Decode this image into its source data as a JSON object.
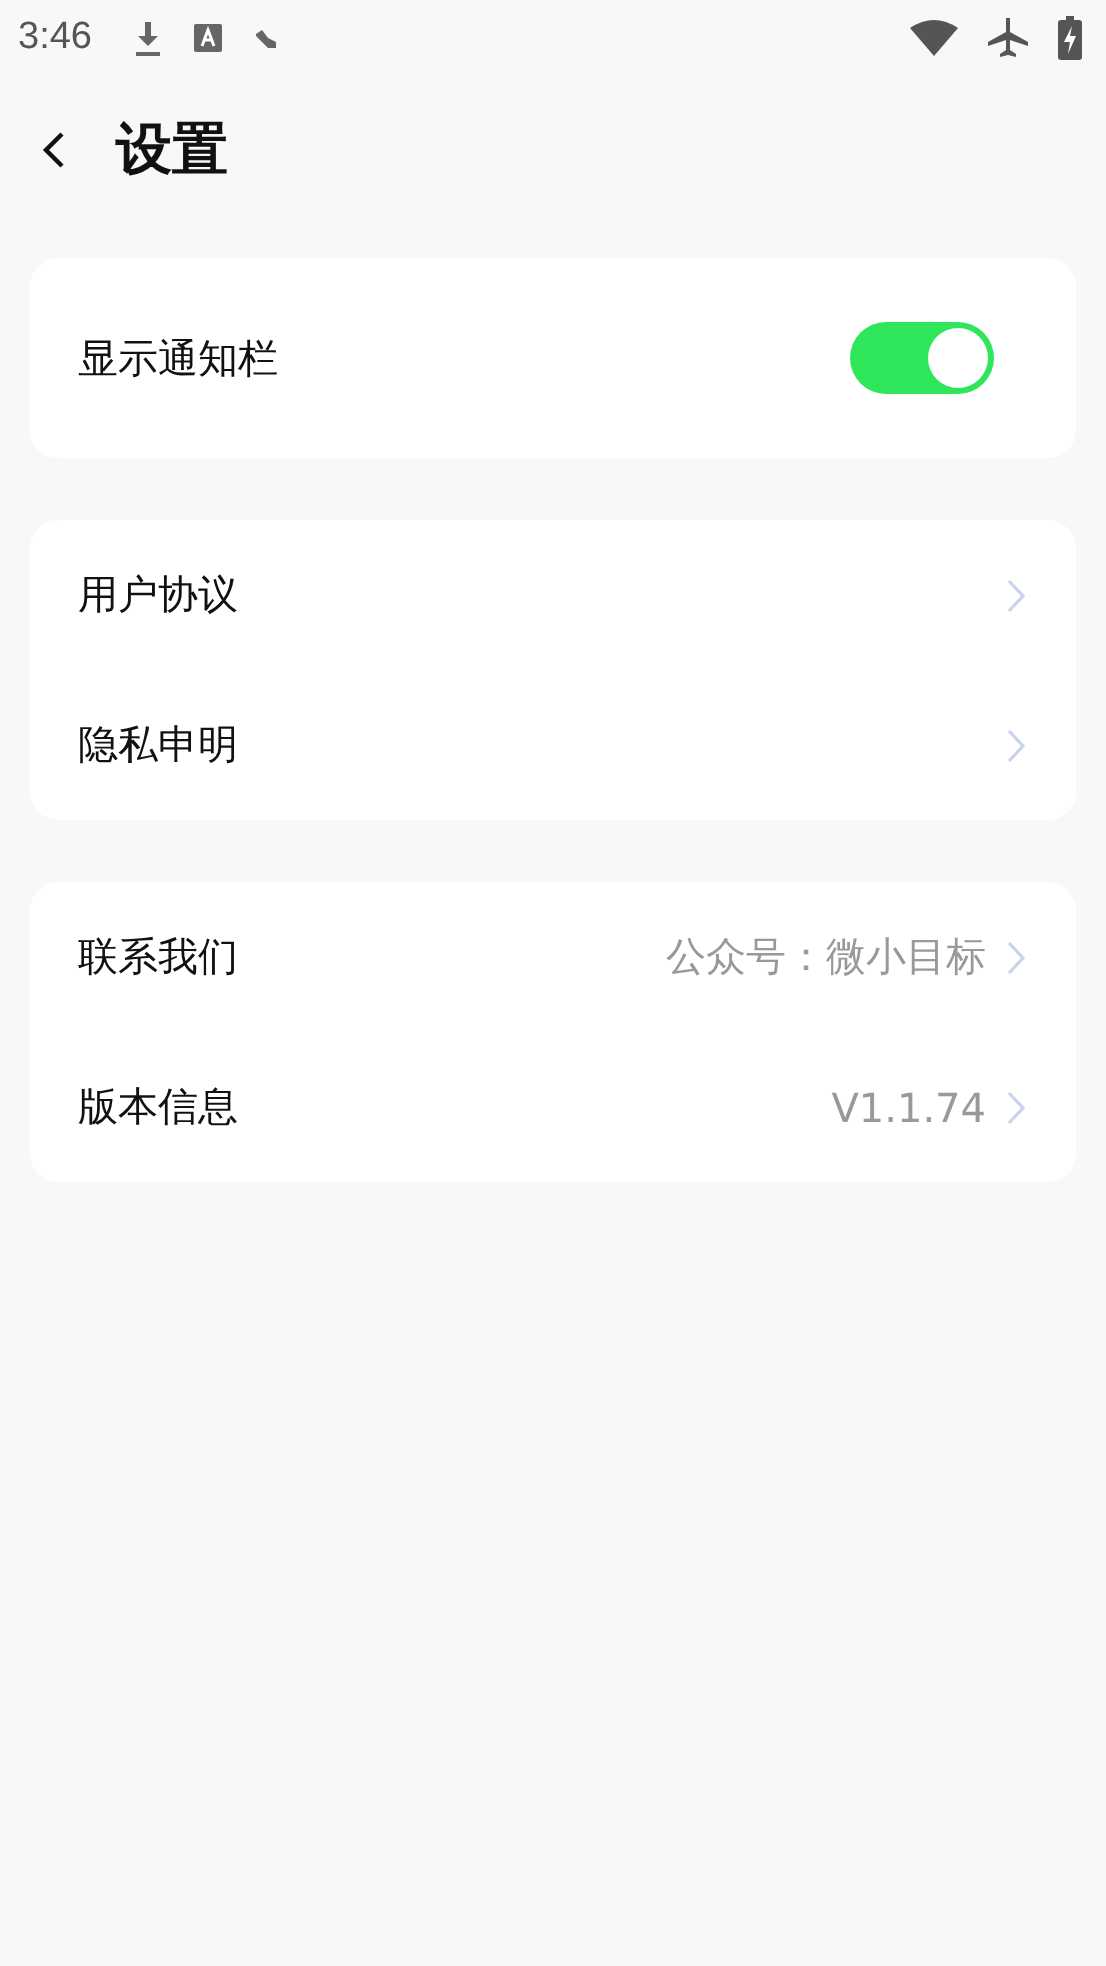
{
  "status_bar": {
    "time": "3:46"
  },
  "header": {
    "title": "设置"
  },
  "groups": [
    {
      "rows": [
        {
          "kind": "toggle",
          "label": "显示通知栏",
          "on": true
        }
      ]
    },
    {
      "rows": [
        {
          "kind": "link",
          "label": "用户协议"
        },
        {
          "kind": "link",
          "label": "隐私申明"
        }
      ]
    },
    {
      "rows": [
        {
          "kind": "link",
          "label": "联系我们",
          "value": "公众号：微小目标"
        },
        {
          "kind": "link",
          "label": "版本信息",
          "value": "V1.1.74"
        }
      ]
    }
  ]
}
